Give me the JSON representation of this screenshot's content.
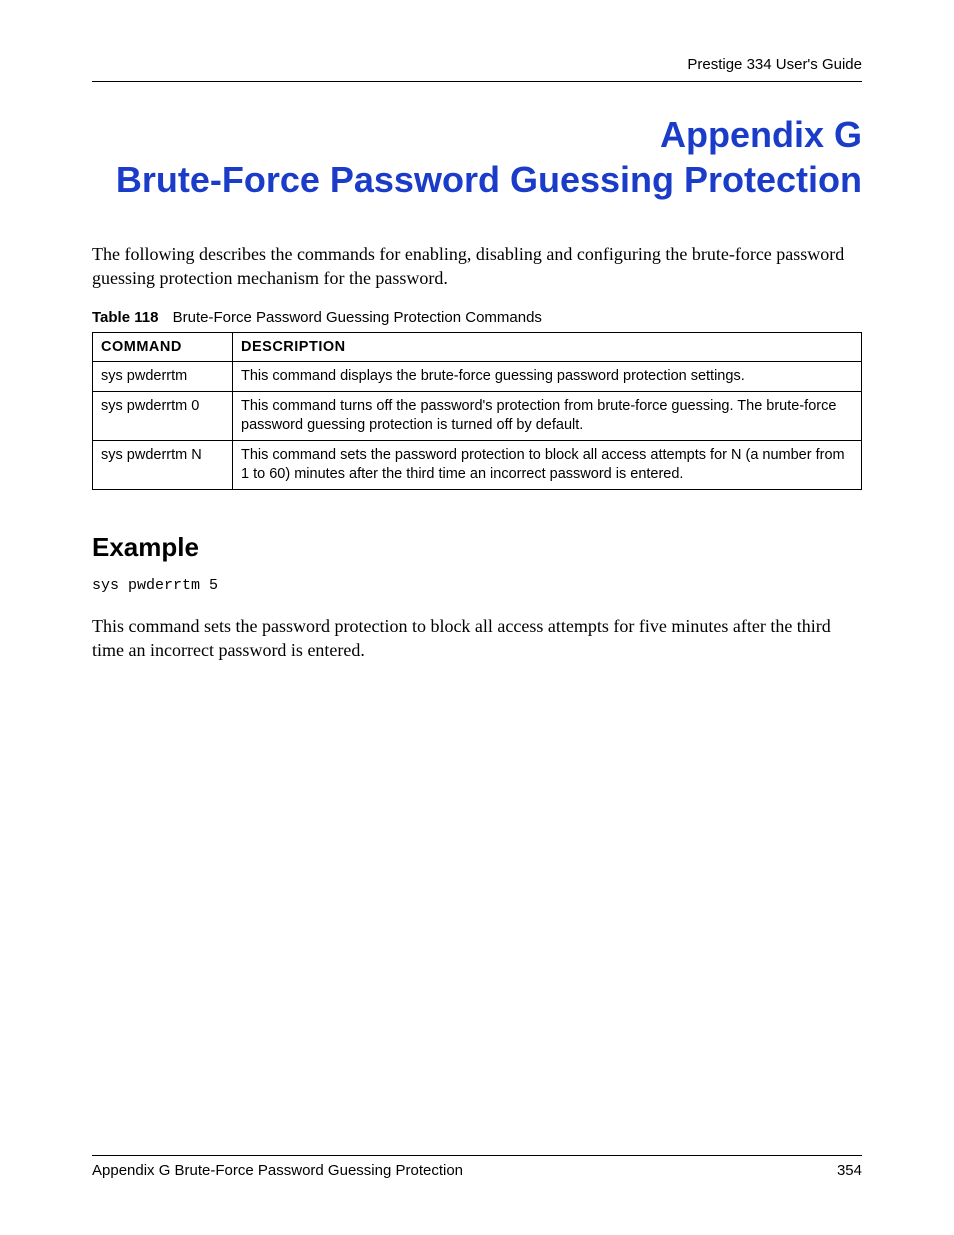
{
  "header": {
    "running_title": "Prestige 334 User's Guide"
  },
  "title": {
    "line1": "Appendix G",
    "line2": "Brute-Force Password Guessing Protection"
  },
  "intro": "The following describes the commands for enabling, disabling and configuring the brute-force password guessing protection mechanism for the password.",
  "table": {
    "caption_label": "Table 118",
    "caption_text": "Brute-Force Password Guessing Protection Commands",
    "headers": {
      "col1": "COMMAND",
      "col2": "DESCRIPTION"
    },
    "rows": [
      {
        "cmd": "sys pwderrtm",
        "desc": "This command displays the brute-force guessing password protection settings."
      },
      {
        "cmd": "sys pwderrtm 0",
        "desc": "This command turns off the password's protection from brute-force guessing. The brute-force password guessing protection is turned off by default."
      },
      {
        "cmd": "sys pwderrtm N",
        "desc": "This command sets the password protection to block all access attempts for N (a number from 1 to 60) minutes after the third time an incorrect password is entered."
      }
    ]
  },
  "example": {
    "heading": "Example",
    "code": "sys pwderrtm 5",
    "explanation": "This command sets the password protection to block all access attempts for five minutes after the third time an incorrect password is entered."
  },
  "footer": {
    "left": "Appendix G Brute-Force Password Guessing Protection",
    "right": "354"
  }
}
